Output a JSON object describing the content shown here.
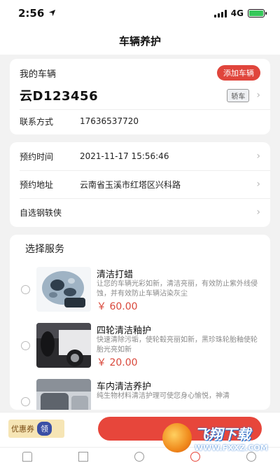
{
  "status_bar": {
    "time": "2:56",
    "network": "4G"
  },
  "nav": {
    "title": "车辆养护"
  },
  "vehicle": {
    "label": "我的车辆",
    "add_button": "添加车辆",
    "plate": "云D123456",
    "type_tag": "轿车",
    "contact_label": "联系方式",
    "contact_value": "17636537720"
  },
  "appointment": {
    "time_label": "预约时间",
    "time_value": "2021-11-17 15:56:46",
    "address_label": "预约地址",
    "address_value": "云南省玉溪市红塔区兴科路",
    "technician_label": "自选钢轶侠"
  },
  "services": {
    "title": "选择服务",
    "items": [
      {
        "name": "清洁打蜡",
        "desc": "让您的车辆光彩如新，清洁亮丽，有效防止紫外线侵蚀，并有效防止车辆沾染灰尘",
        "price": "￥ 60.00"
      },
      {
        "name": "四轮清洁釉护",
        "desc": "快速清除污垢，使轮毂亮丽如新，黑珍珠轮胎釉使轮胎光亮如新",
        "price": "￥ 20.00"
      },
      {
        "name": "车内清洁养护",
        "desc": "纯生物材料清洁护理可使您身心愉悦，神清",
        "price": ""
      }
    ]
  },
  "bottom": {
    "coupon_label": "优惠券",
    "coupon_claim": "领"
  },
  "watermark": {
    "cn": "飞翔下载",
    "en": "WWW.FXXZ.COM"
  }
}
